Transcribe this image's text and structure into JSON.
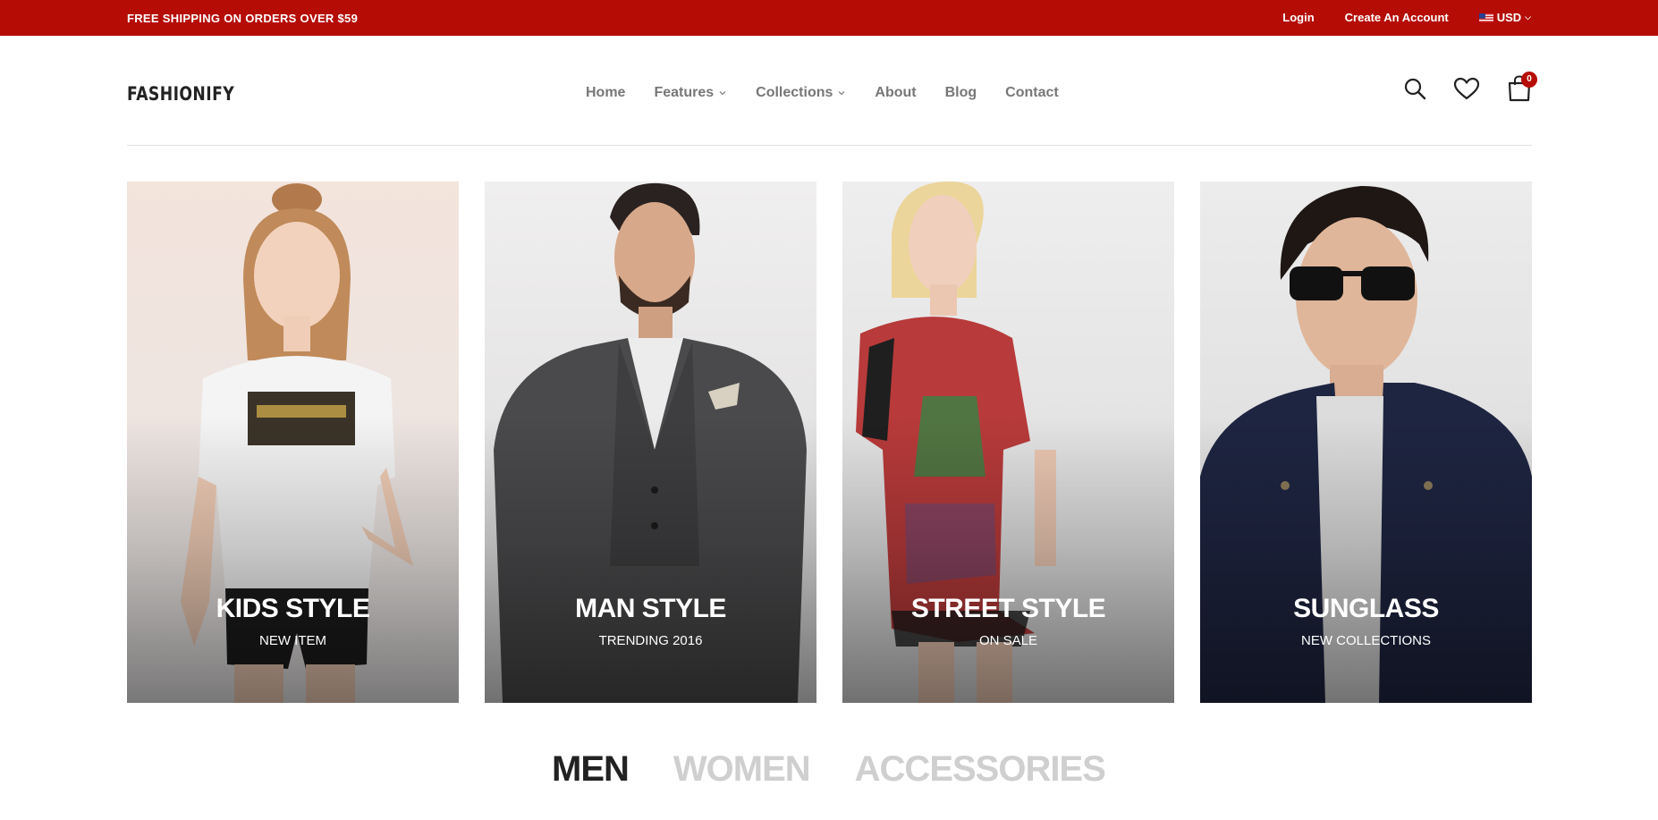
{
  "topbar": {
    "promo": "FREE SHIPPING ON ORDERS OVER $59",
    "login": "Login",
    "create_account": "Create An Account",
    "currency": "USD",
    "background": "#b50c06"
  },
  "header": {
    "logo": "FASHIONIFY",
    "nav": [
      {
        "label": "Home"
      },
      {
        "label": "Features"
      },
      {
        "label": "Collections"
      },
      {
        "label": "About"
      },
      {
        "label": "Blog"
      },
      {
        "label": "Contact"
      }
    ],
    "cart_count": "0",
    "icons": [
      "search-icon",
      "heart-icon",
      "cart-icon"
    ]
  },
  "banners": [
    {
      "title": "KIDS STYLE",
      "subtitle": "NEW ITEM"
    },
    {
      "title": "MAN STYLE",
      "subtitle": "TRENDING 2016"
    },
    {
      "title": "STREET STYLE",
      "subtitle": "ON SALE"
    },
    {
      "title": "SUNGLASS",
      "subtitle": "NEW COLLECTIONS"
    }
  ],
  "tabs": [
    {
      "label": "MEN",
      "active": true
    },
    {
      "label": "WOMEN",
      "active": false
    },
    {
      "label": "ACCESSORIES",
      "active": false
    }
  ]
}
